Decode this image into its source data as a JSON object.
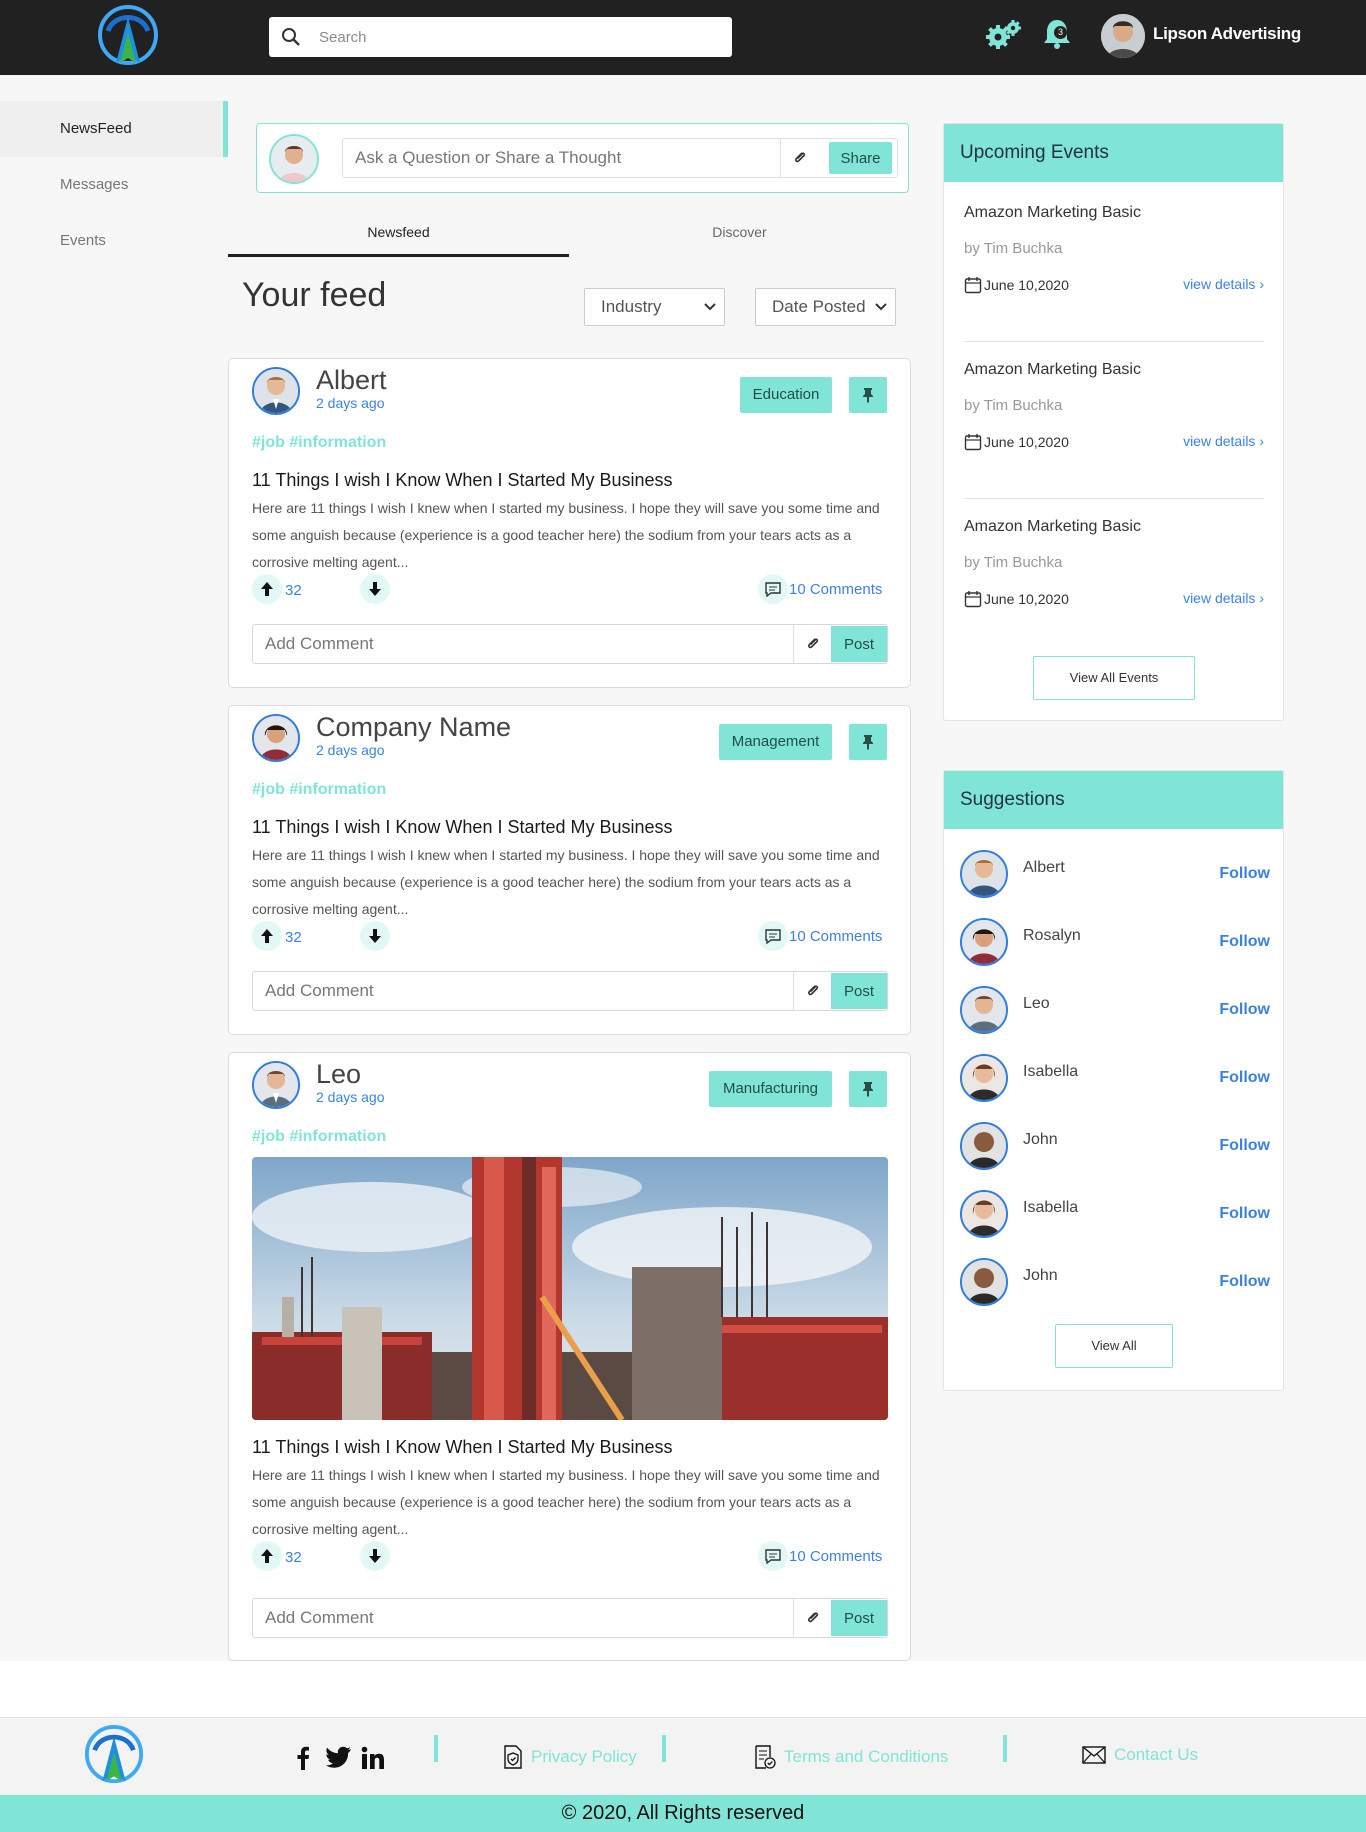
{
  "header": {
    "search_placeholder": "Search",
    "notification_count": "3",
    "user_name": "Lipson Advertising"
  },
  "sidebar": {
    "items": [
      {
        "label": "NewsFeed",
        "active": true
      },
      {
        "label": "Messages",
        "active": false
      },
      {
        "label": "Events",
        "active": false
      }
    ]
  },
  "composer": {
    "placeholder": "Ask a Question or Share a Thought",
    "share_label": "Share"
  },
  "tabs": [
    {
      "label": "Newsfeed",
      "active": true
    },
    {
      "label": "Discover",
      "active": false
    }
  ],
  "feed": {
    "title": "Your feed",
    "filters": [
      {
        "selected": "Industry"
      },
      {
        "selected": "Date Posted"
      }
    ]
  },
  "posts": [
    {
      "author": "Albert",
      "time": "2 days ago",
      "category": "Education",
      "tags": "#job #information",
      "title": "11 Things I wish I Know When I Started My Business",
      "body": "Here are 11 things I wish I knew when I started my business. I hope they will save you some time and some anguish because (experience is a good teacher here) the sodium from your tears acts as a corrosive melting agent...",
      "votes": "32",
      "comments": "10 Comments",
      "comment_placeholder": "Add Comment",
      "post_label": "Post"
    },
    {
      "author": "Company Name",
      "time": "2 days ago",
      "category": "Management",
      "tags": "#job #information",
      "title": "11 Things I wish I Know When I Started My Business",
      "body": "Here are 11 things I wish I knew when I started my business. I hope they will save you some time and some anguish because (experience is a good teacher here) the sodium from your tears acts as a corrosive melting agent...",
      "votes": "32",
      "comments": "10 Comments",
      "comment_placeholder": "Add Comment",
      "post_label": "Post"
    },
    {
      "author": "Leo",
      "time": "2 days ago",
      "category": "Manufacturing",
      "tags": "#job #information",
      "title": "11 Things I wish I Know When I Started My Business",
      "body": "Here are 11 things I wish I knew when I started my business. I hope they will save you some time and some anguish because (experience is a good teacher here) the sodium from your tears acts as a corrosive melting agent...",
      "votes": "32",
      "comments": "10 Comments",
      "comment_placeholder": "Add Comment",
      "post_label": "Post"
    }
  ],
  "events_panel": {
    "title": "Upcoming Events",
    "events": [
      {
        "title": "Amazon Marketing Basic",
        "by": "by Tim Buchka",
        "date": "June 10,2020",
        "link": "view details"
      },
      {
        "title": "Amazon Marketing Basic",
        "by": "by Tim Buchka",
        "date": "June 10,2020",
        "link": "view details"
      },
      {
        "title": "Amazon Marketing Basic",
        "by": "by Tim Buchka",
        "date": "June 10,2020",
        "link": "view details"
      }
    ],
    "view_all_label": "View All Events"
  },
  "suggestions_panel": {
    "title": "Suggestions",
    "people": [
      {
        "name": "Albert",
        "action": "Follow"
      },
      {
        "name": "Rosalyn",
        "action": "Follow"
      },
      {
        "name": "Leo",
        "action": "Follow"
      },
      {
        "name": "Isabella",
        "action": "Follow"
      },
      {
        "name": "John",
        "action": "Follow"
      },
      {
        "name": "Isabella",
        "action": "Follow"
      },
      {
        "name": "John",
        "action": "Follow"
      }
    ],
    "view_all_label": "View All"
  },
  "footer": {
    "links": [
      {
        "label": "Privacy Policy",
        "icon": "shield-doc-icon"
      },
      {
        "label": "Terms and Conditions",
        "icon": "doc-check-icon"
      },
      {
        "label": "Contact Us",
        "icon": "envelope-icon"
      }
    ],
    "social": [
      "facebook-icon",
      "twitter-icon",
      "linkedin-icon"
    ],
    "copyright": "© 2020, All Rights reserved"
  },
  "colors": {
    "accent": "#80e5d6",
    "header_bg": "#212121",
    "link_blue": "#3b82e0"
  }
}
